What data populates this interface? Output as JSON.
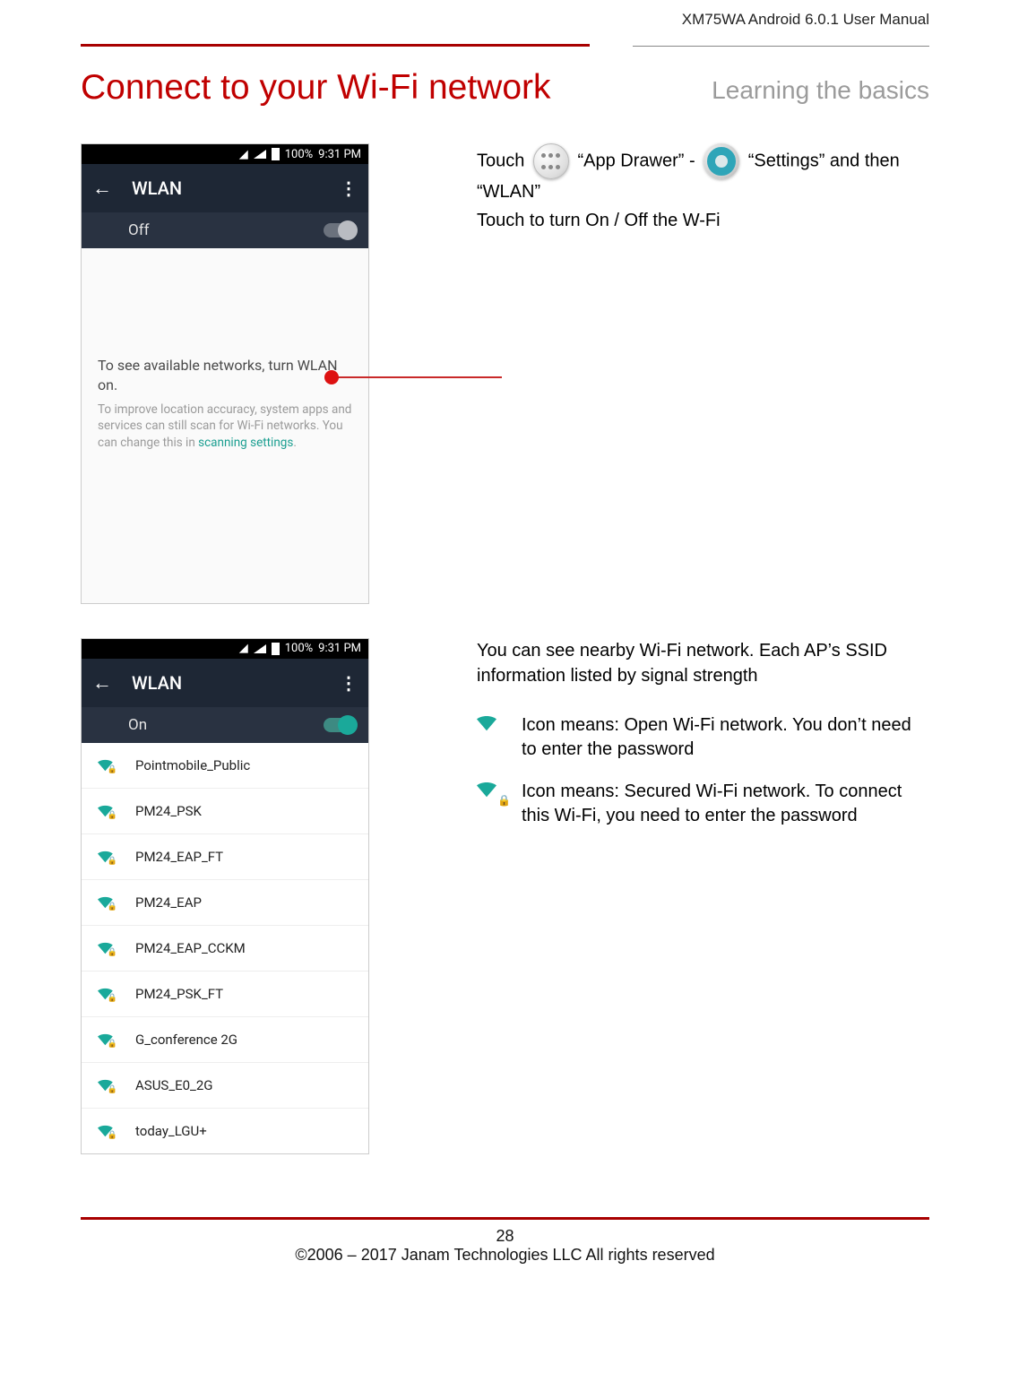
{
  "header": "XM75WA Android 6.0.1 User Manual",
  "title": "Connect to your Wi-Fi network",
  "subtitle": "Learning the basics",
  "statusbar": {
    "battery": "100%",
    "time": "9:31 PM"
  },
  "appbar": {
    "title": "WLAN"
  },
  "phone1": {
    "toggle_label": "Off",
    "msg_main": "To see available networks, turn WLAN on.",
    "msg_sub_a": "To improve location accuracy, system apps and services can still scan for Wi-Fi networks. You can change this in ",
    "msg_sub_link": "scanning settings",
    "msg_sub_b": "."
  },
  "instructions1": {
    "touch": "Touch",
    "app_drawer": "“App Drawer” -",
    "settings_then": "“Settings” and then “WLAN”",
    "line2": "Touch to turn On / Off the W-Fi"
  },
  "phone2": {
    "toggle_label": "On",
    "networks": [
      {
        "ssid": "Pointmobile_Public",
        "secured": true
      },
      {
        "ssid": "PM24_PSK",
        "secured": true
      },
      {
        "ssid": "PM24_EAP_FT",
        "secured": true
      },
      {
        "ssid": "PM24_EAP",
        "secured": true
      },
      {
        "ssid": "PM24_EAP_CCKM",
        "secured": true
      },
      {
        "ssid": "PM24_PSK_FT",
        "secured": true
      },
      {
        "ssid": "G_conference 2G",
        "secured": true
      },
      {
        "ssid": "ASUS_E0_2G",
        "secured": true
      },
      {
        "ssid": "today_LGU+",
        "secured": true
      }
    ]
  },
  "instructions2": {
    "intro": "You can see nearby Wi-Fi network. Each AP’s SSID information listed by signal strength",
    "open": "Icon means: Open Wi-Fi network. You don’t need to enter the password",
    "secured": "Icon means: Secured Wi-Fi network. To connect this Wi-Fi, you need to enter the password"
  },
  "footer": {
    "page": "28",
    "copyright": "©2006 – 2017 Janam Technologies LLC All rights reserved"
  }
}
